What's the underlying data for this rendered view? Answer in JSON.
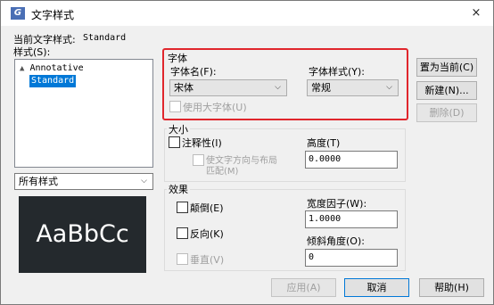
{
  "window": {
    "app_icon": "G",
    "title": "文字样式",
    "close": "×"
  },
  "current_style": {
    "label": "当前文字样式:",
    "value": "Standard"
  },
  "styles": {
    "label": "样式(S):",
    "items": [
      {
        "name": "Annotative",
        "icon": "annotative-icon",
        "selected": false
      },
      {
        "name": "Standard",
        "selected": true
      }
    ],
    "filter_value": "所有样式"
  },
  "preview": {
    "text": "AaBbCc"
  },
  "font": {
    "group_label": "字体",
    "name_label": "字体名(F):",
    "name_value": "宋体",
    "style_label": "字体样式(Y):",
    "style_value": "常规",
    "bigfont_label": "使用大字体(U)"
  },
  "size": {
    "group_label": "大小",
    "annotative_label": "注释性(I)",
    "orient_label_line1": "使文字方向与布局",
    "orient_label_line2": "匹配(M)",
    "height_label": "高度(T)",
    "height_value": "0.0000"
  },
  "effects": {
    "group_label": "效果",
    "upside_down_label": "颠倒(E)",
    "backwards_label": "反向(K)",
    "vertical_label": "垂直(V)",
    "width_factor_label": "宽度因子(W):",
    "width_factor_value": "1.0000",
    "oblique_label": "倾斜角度(O):",
    "oblique_value": "0"
  },
  "buttons": {
    "set_current": "置为当前(C)",
    "new": "新建(N)...",
    "delete": "删除(D)",
    "apply": "应用(A)",
    "cancel": "取消",
    "help": "帮助(H)"
  },
  "colors": {
    "highlight_border": "#e0262c",
    "selection": "#0078d7",
    "preview_bg": "#24292d"
  }
}
